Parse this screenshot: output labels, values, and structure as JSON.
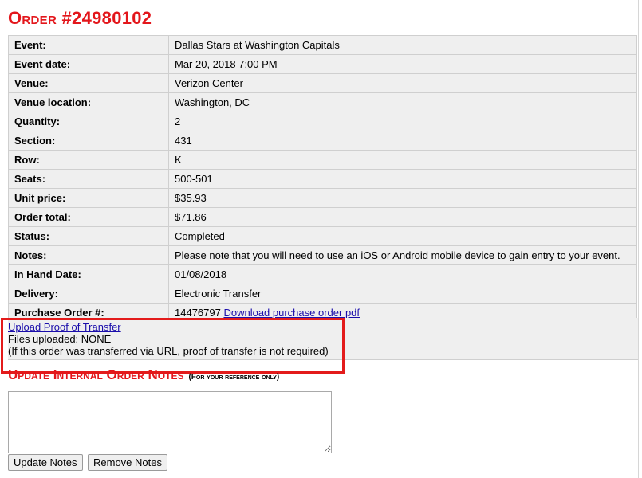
{
  "order": {
    "title": "Order #24980102"
  },
  "details": {
    "rows": [
      {
        "label": "Event:",
        "value": "Dallas Stars at Washington Capitals"
      },
      {
        "label": "Event date:",
        "value": "Mar 20, 2018 7:00 PM"
      },
      {
        "label": "Venue:",
        "value": "Verizon Center"
      },
      {
        "label": "Venue location:",
        "value": "Washington, DC"
      },
      {
        "label": "Quantity:",
        "value": "2"
      },
      {
        "label": "Section:",
        "value": "431"
      },
      {
        "label": "Row:",
        "value": "K"
      },
      {
        "label": "Seats:",
        "value": "500-501"
      },
      {
        "label": "Unit price:",
        "value": "$35.93"
      },
      {
        "label": "Order total:",
        "value": "$71.86"
      },
      {
        "label": "Status:",
        "value": "Completed"
      },
      {
        "label": "Notes:",
        "value": "Please note that you will need to use an iOS or Android mobile device to gain entry to your event."
      },
      {
        "label": "In Hand Date:",
        "value": "01/08/2018"
      },
      {
        "label": "Delivery:",
        "value": "Electronic Transfer"
      }
    ],
    "purchase_order": {
      "label": "Purchase Order #:",
      "number": "14476797",
      "download_link": "Download purchase order pdf"
    }
  },
  "proof": {
    "upload_link": "Upload Proof of Transfer",
    "files_uploaded": "Files uploaded: NONE",
    "note": "(If this order was transferred via URL, proof of transfer is not required)"
  },
  "notes_section": {
    "heading": "Update Internal Order Notes",
    "subheading": "(For your reference only)",
    "textarea_value": ""
  },
  "buttons": {
    "update": "Update Notes",
    "remove": "Remove Notes"
  },
  "colors": {
    "accent_red": "#e3161b",
    "table_bg": "#efefef",
    "link": "#1a0dab"
  }
}
